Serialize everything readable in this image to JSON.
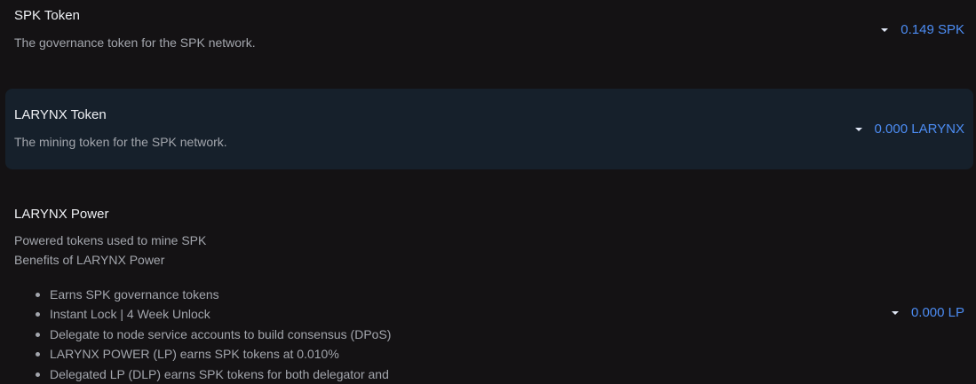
{
  "tokens": [
    {
      "title": "SPK Token",
      "description": "The governance token for the SPK network.",
      "balance": "0.149 SPK"
    },
    {
      "title": "LARYNX Token",
      "description": "The mining token for the SPK network.",
      "balance": "0.000 LARYNX"
    }
  ],
  "power": {
    "title": "LARYNX Power",
    "description": "Powered tokens used to mine SPK",
    "benefits_heading": "Benefits of LARYNX Power",
    "benefits": [
      "Earns SPK governance tokens",
      "Instant Lock | 4 Week Unlock",
      "Delegate to node service accounts to build consensus (DPoS)",
      "LARYNX POWER (LP) earns SPK tokens at 0.010%",
      "Delegated LP (DLP) earns SPK tokens for both delegator and"
    ],
    "balance": "0.000 LP"
  },
  "colors": {
    "background": "#141214",
    "highlight_row": "#16202b",
    "accent": "#4c8cf3",
    "muted_text": "#a3a6ad"
  }
}
